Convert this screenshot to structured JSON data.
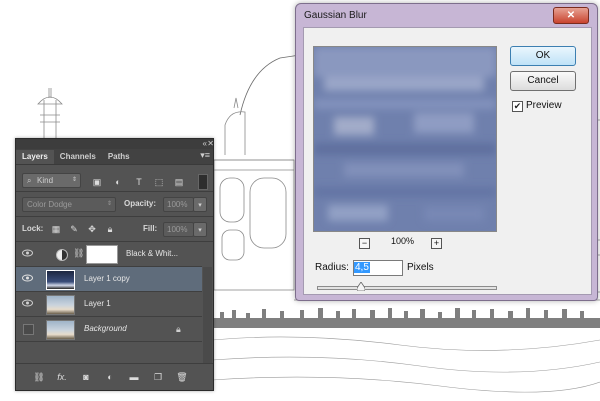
{
  "layers_panel": {
    "tabs": [
      {
        "label": "Layers",
        "active": true
      },
      {
        "label": "Channels",
        "active": false
      },
      {
        "label": "Paths",
        "active": false
      }
    ],
    "filter_label": "Kind",
    "blend_mode": "Color Dodge",
    "opacity_label": "Opacity:",
    "opacity_value": "100%",
    "lock_label": "Lock:",
    "fill_label": "Fill:",
    "fill_value": "100%",
    "layers": [
      {
        "name": "Black & Whit...",
        "visible": true,
        "selected": false,
        "italic": false,
        "thumb": "adjustment"
      },
      {
        "name": "Layer 1 copy",
        "visible": true,
        "selected": true,
        "italic": false,
        "thumb": "photo-night"
      },
      {
        "name": "Layer 1",
        "visible": true,
        "selected": false,
        "italic": false,
        "thumb": "photo-day"
      },
      {
        "name": "Background",
        "visible": false,
        "selected": false,
        "italic": true,
        "thumb": "photo-day"
      }
    ],
    "bottom_icons": [
      "link-icon",
      "fx-icon",
      "mask-icon",
      "adjustment-icon",
      "folder-icon",
      "new-layer-icon",
      "trash-icon"
    ],
    "fx_label": "fx."
  },
  "gaussian_blur": {
    "title": "Gaussian Blur",
    "close_symbol": "✕",
    "ok_label": "OK",
    "cancel_label": "Cancel",
    "preview_label": "Preview",
    "preview_checked": true,
    "zoom_out_symbol": "−",
    "zoom_in_symbol": "+",
    "zoom_value": "100%",
    "radius_label": "Radius:",
    "radius_value": "4,5",
    "radius_unit": "Pixels",
    "slider_level": 0.24
  },
  "colors": {
    "panel_bg": "#535353",
    "selected_layer": "#5f6c7b",
    "dialog_frame": "#c7b6d5",
    "preview_blue": "#6d7fae"
  }
}
